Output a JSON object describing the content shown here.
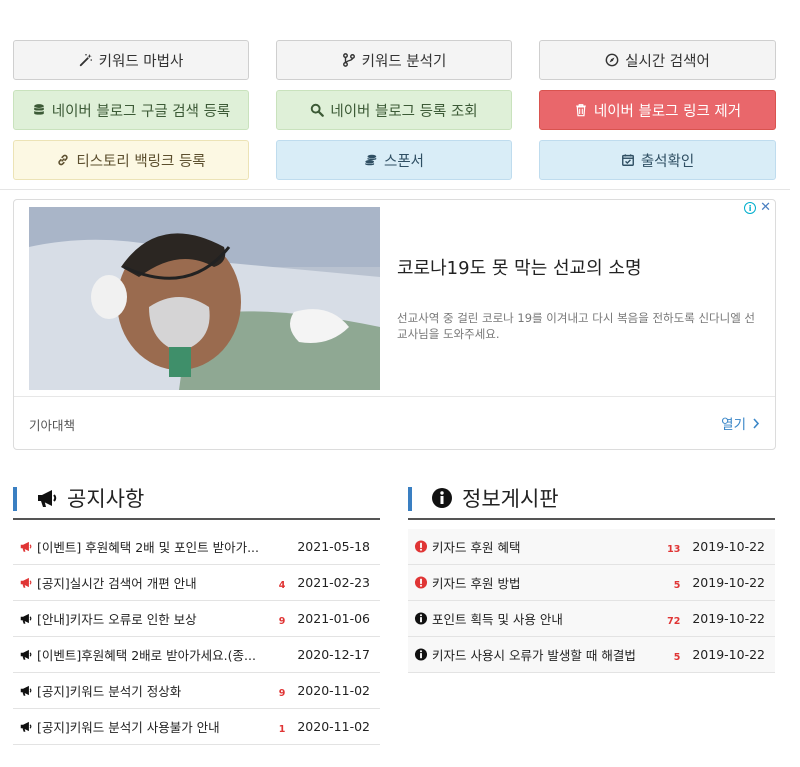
{
  "buttons": [
    {
      "label": "키워드 마법사",
      "icon": "magic-wand-icon",
      "style": "default"
    },
    {
      "label": "키워드 분석기",
      "icon": "code-branch-icon",
      "style": "default"
    },
    {
      "label": "실시간 검색어",
      "icon": "compass-icon",
      "style": "default"
    },
    {
      "label": "네이버 블로그 구글 검색 등록",
      "icon": "database-icon",
      "style": "success"
    },
    {
      "label": "네이버 블로그 등록 조회",
      "icon": "search-icon",
      "style": "success"
    },
    {
      "label": "네이버 블로그 링크 제거",
      "icon": "trash-icon",
      "style": "danger"
    },
    {
      "label": "티스토리 백링크 등록",
      "icon": "link-icon",
      "style": "warning"
    },
    {
      "label": "스폰서",
      "icon": "coins-icon",
      "style": "info"
    },
    {
      "label": "출석확인",
      "icon": "calendar-check-icon",
      "style": "info"
    }
  ],
  "ad": {
    "title": "코로나19도 못 막는 선교의 소명",
    "description": "선교사역 중 걸린 코로나 19를 이겨내고 다시 복음을 전하도록 신다니엘 선교사님을 도와주세요.",
    "sponsor": "기아대책",
    "open_label": "열기"
  },
  "notice": {
    "title": "공지사항",
    "rows": [
      {
        "title": "[이벤트] 후원혜택 2배 및 포인트 받아가...",
        "count": "",
        "date": "2021-05-18",
        "hot": true
      },
      {
        "title": "[공지]실시간 검색어 개편 안내",
        "count": "4",
        "date": "2021-02-23",
        "hot": true
      },
      {
        "title": "[안내]키자드 오류로 인한 보상",
        "count": "9",
        "date": "2021-01-06",
        "hot": false
      },
      {
        "title": "[이벤트]후원혜택 2배로 받아가세요.(종...",
        "count": "",
        "date": "2020-12-17",
        "hot": false
      },
      {
        "title": "[공지]키워드 분석기 정상화",
        "count": "9",
        "date": "2020-11-02",
        "hot": false
      },
      {
        "title": "[공지]키워드 분석기 사용불가 안내",
        "count": "1",
        "date": "2020-11-02",
        "hot": false
      }
    ]
  },
  "info_board": {
    "title": "정보게시판",
    "rows": [
      {
        "title": "키자드 후원 혜택",
        "count": "13",
        "date": "2019-10-22",
        "hot": true
      },
      {
        "title": "키자드 후원 방법",
        "count": "5",
        "date": "2019-10-22",
        "hot": true
      },
      {
        "title": "포인트 획득 및 사용 안내",
        "count": "72",
        "date": "2019-10-22",
        "hot": false
      },
      {
        "title": "키자드 사용시 오류가 발생할 때 해결법",
        "count": "5",
        "date": "2019-10-22",
        "hot": false
      }
    ]
  },
  "colors": {
    "accent_bar": "#3a7fc2",
    "hot_red": "#e03535",
    "danger": "#e9676b"
  }
}
